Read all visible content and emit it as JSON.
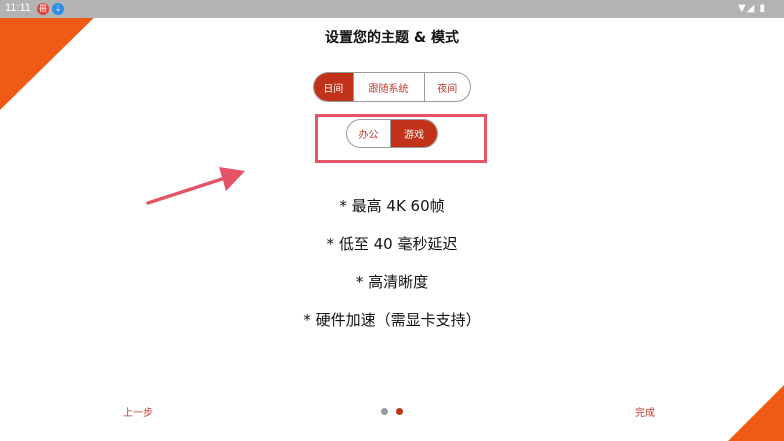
{
  "status_bar": {
    "time": "11:11",
    "badge_1": "冊",
    "badge_2": "⇣",
    "right_icons": "▼◢ ▮"
  },
  "title": "设置您的主题 & 模式",
  "theme_options": [
    "日间",
    "跟随系统",
    "夜间"
  ],
  "theme_selected": 0,
  "mode_options": [
    "办公",
    "游戏"
  ],
  "mode_selected": 1,
  "features": [
    "* 最高 4K 60帧",
    "* 低至 40 毫秒延迟",
    "* 高清晰度",
    "* 硬件加速（需显卡支持）"
  ],
  "footer": {
    "back": "上一步",
    "done": "完成",
    "page_count": 2,
    "current_page": 2
  },
  "colors": {
    "accent": "#c0321a",
    "accent_text": "#c0392b",
    "corner": "#f05a14",
    "annotation": "#e35466",
    "status_bar": "#b3b3b3"
  }
}
